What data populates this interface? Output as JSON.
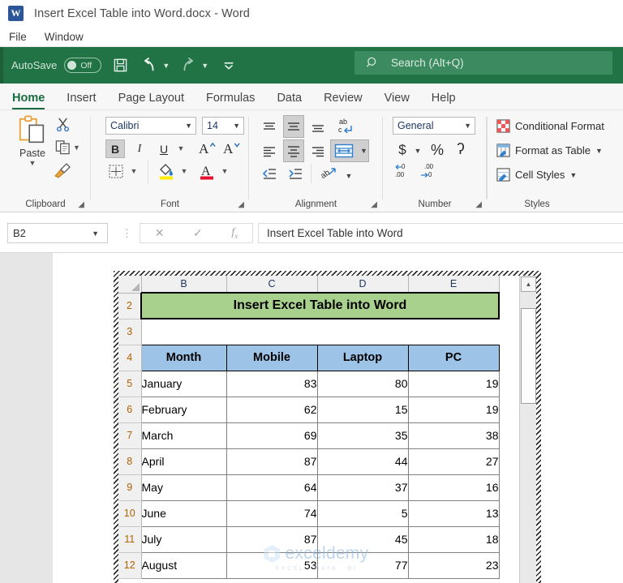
{
  "titlebar": {
    "app_icon": "word-icon",
    "title": "Insert Excel Table into Word.docx - Word"
  },
  "word_menu": {
    "items": [
      {
        "label": "File"
      },
      {
        "label": "Window"
      }
    ]
  },
  "quick_access": {
    "autosave_label": "AutoSave",
    "autosave_state": "Off",
    "buttons": [
      {
        "name": "save-button",
        "icon": "save-icon"
      },
      {
        "name": "undo-button",
        "icon": "undo-icon"
      },
      {
        "name": "redo-button",
        "icon": "redo-icon"
      },
      {
        "name": "customize-qat-button",
        "icon": "chevron-down-bar-icon"
      }
    ],
    "bar_color": "#217346"
  },
  "search": {
    "placeholder": "Search (Alt+Q)",
    "icon": "search-icon"
  },
  "ribbon": {
    "tabs": [
      {
        "label": "Home",
        "active": true
      },
      {
        "label": "Insert",
        "active": false
      },
      {
        "label": "Page Layout",
        "active": false
      },
      {
        "label": "Formulas",
        "active": false
      },
      {
        "label": "Data",
        "active": false
      },
      {
        "label": "Review",
        "active": false
      },
      {
        "label": "View",
        "active": false
      },
      {
        "label": "Help",
        "active": false
      }
    ],
    "groups": {
      "clipboard": {
        "label": "Clipboard",
        "paste_label": "Paste",
        "buttons": [
          {
            "name": "cut-button",
            "icon": "scissors-icon"
          },
          {
            "name": "copy-button",
            "icon": "copy-icon"
          },
          {
            "name": "format-painter-button",
            "icon": "paintbrush-icon"
          }
        ]
      },
      "font": {
        "label": "Font",
        "font_name": "Calibri",
        "font_size": "14",
        "bold": "B",
        "italic": "I",
        "underline": "U",
        "grow_font": "A",
        "shrink_font": "A",
        "buttons": [
          {
            "name": "borders-button",
            "icon": "borders-icon"
          },
          {
            "name": "fill-color-button",
            "icon": "fill-color-icon"
          },
          {
            "name": "font-color-button",
            "icon": "font-color-icon"
          }
        ]
      },
      "alignment": {
        "label": "Alignment",
        "buttons": [
          {
            "name": "align-top-button",
            "icon": "align-top-icon"
          },
          {
            "name": "align-middle-button",
            "icon": "align-middle-icon"
          },
          {
            "name": "align-bottom-button",
            "icon": "align-bottom-icon"
          },
          {
            "name": "wrap-text-button",
            "icon": "wrap-text-icon"
          },
          {
            "name": "align-left-button",
            "icon": "align-left-icon"
          },
          {
            "name": "align-center-button",
            "icon": "align-center-icon"
          },
          {
            "name": "align-right-button",
            "icon": "align-right-icon"
          },
          {
            "name": "merge-center-button",
            "icon": "merge-cells-icon"
          },
          {
            "name": "decrease-indent-button",
            "icon": "decrease-indent-icon"
          },
          {
            "name": "increase-indent-button",
            "icon": "increase-indent-icon"
          },
          {
            "name": "orientation-button",
            "icon": "text-orientation-icon"
          }
        ]
      },
      "number": {
        "label": "Number",
        "format": "General",
        "currency": "$",
        "percent": "%",
        "comma": "ʔ",
        "increase_decimal": ".00",
        "decrease_decimal": ".00"
      },
      "styles": {
        "label": "Styles",
        "items": [
          {
            "label": "Conditional Format",
            "icon": "conditional-formatting-icon",
            "caret": false
          },
          {
            "label": "Format as Table",
            "icon": "format-as-table-icon",
            "caret": true
          },
          {
            "label": "Cell Styles",
            "icon": "cell-styles-icon",
            "caret": true
          }
        ]
      }
    }
  },
  "formula_bar": {
    "name_box": "B2",
    "cancel_icon": "close-icon",
    "enter_icon": "check-icon",
    "function_icon": "fx-icon",
    "value": "Insert Excel Table into Word"
  },
  "embedded_sheet": {
    "columns": [
      "B",
      "C",
      "D",
      "E"
    ],
    "rows": [
      {
        "num": "2",
        "type": "title",
        "cells": [
          "Insert Excel Table into Word"
        ]
      },
      {
        "num": "3",
        "type": "blank",
        "cells": [
          "",
          "",
          "",
          ""
        ]
      },
      {
        "num": "4",
        "type": "header",
        "cells": [
          "Month",
          "Mobile",
          "Laptop",
          "PC"
        ]
      },
      {
        "num": "5",
        "type": "data",
        "cells": [
          "January",
          "83",
          "80",
          "19"
        ]
      },
      {
        "num": "6",
        "type": "data",
        "cells": [
          "February",
          "62",
          "15",
          "19"
        ]
      },
      {
        "num": "7",
        "type": "data",
        "cells": [
          "March",
          "69",
          "35",
          "38"
        ]
      },
      {
        "num": "8",
        "type": "data",
        "cells": [
          "April",
          "87",
          "44",
          "27"
        ]
      },
      {
        "num": "9",
        "type": "data",
        "cells": [
          "May",
          "64",
          "37",
          "16"
        ]
      },
      {
        "num": "10",
        "type": "data",
        "cells": [
          "June",
          "74",
          "5",
          "13"
        ]
      },
      {
        "num": "11",
        "type": "data",
        "cells": [
          "July",
          "87",
          "45",
          "18"
        ]
      },
      {
        "num": "12",
        "type": "data",
        "cells": [
          "August",
          "53",
          "77",
          "23"
        ]
      }
    ],
    "title_fill": "#A9D18E",
    "header_fill": "#9DC3E6",
    "scrollbar": {
      "up_icon": "caret-up-icon"
    }
  },
  "watermark": {
    "name": "exceldemy",
    "tagline": "EXCEL · DATA · BI"
  }
}
